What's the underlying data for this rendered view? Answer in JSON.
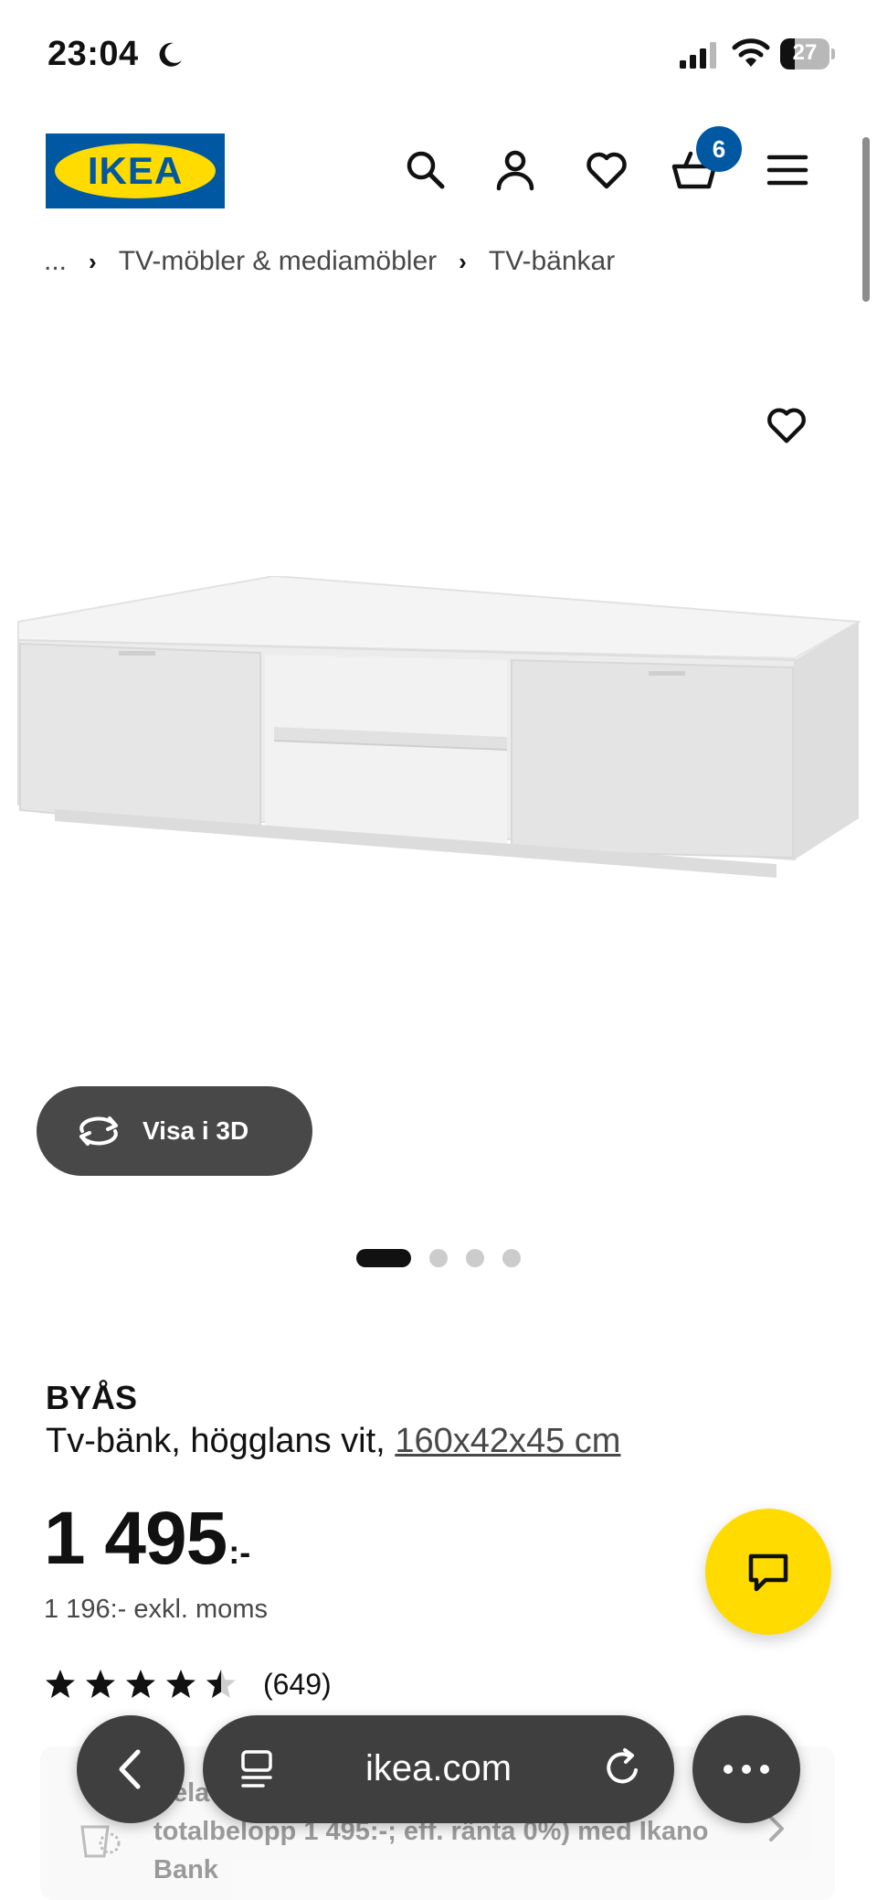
{
  "status_bar": {
    "time": "23:04",
    "battery": "27"
  },
  "header": {
    "logo_text": "IKEA",
    "cart_count": "6",
    "icons": [
      "search-icon",
      "account-icon",
      "heart-icon",
      "cart-icon",
      "menu-icon"
    ],
    "brand_blue": "#0058a3",
    "brand_yellow": "#ffdb00"
  },
  "breadcrumb": {
    "items": [
      "...",
      "TV-möbler & mediamöbler",
      "TV-bänkar"
    ],
    "separator": "›"
  },
  "hero": {
    "view_3d_label": "Visa i 3D",
    "image_count": 4,
    "active_image": 1
  },
  "product": {
    "name": "BYÅS",
    "description": "Tv-bänk, högglans vit, ",
    "size": "160x42x45 cm",
    "price": "1 495",
    "price_suffix": ":-",
    "price_ex_vat": "1 196:- exkl. moms",
    "rating_value": 4.5,
    "rating_max": 5,
    "rating_count": "(649)"
  },
  "promo": {
    "text": "Dela upp betalningen (ex. 12 mån, totalbelopp 1 495:-; eff. ränta 0%) med Ikano Bank"
  },
  "browser": {
    "url": "ikea.com"
  },
  "colors": {
    "chat_button": "#ffdb00",
    "view_3d_bg": "#484848",
    "browser_bg": "#3f3f3f"
  }
}
